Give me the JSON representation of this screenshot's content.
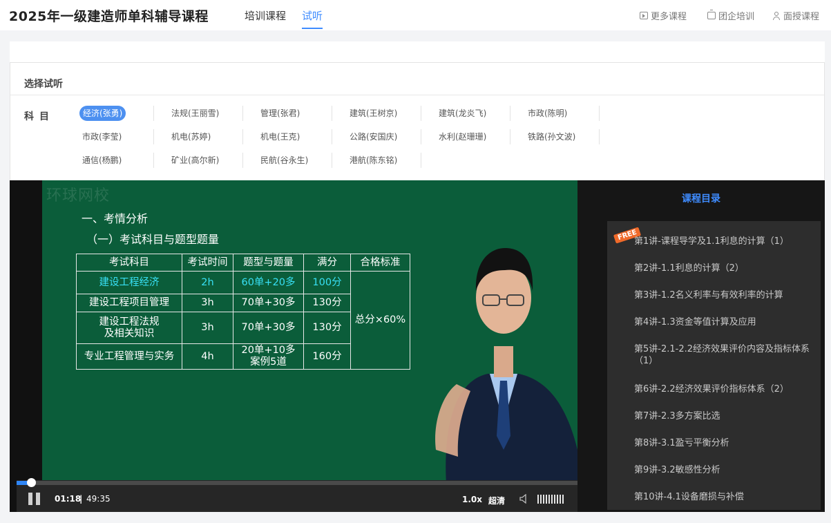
{
  "header": {
    "title": "2025年一级建造师单科辅导课程",
    "tabs": [
      "培训课程",
      "试听"
    ],
    "links": [
      "更多课程",
      "团企培训",
      "面授课程"
    ]
  },
  "selector": {
    "title": "选择试听",
    "subject_label": "科目",
    "subjects": [
      "经济(张勇)",
      "法规(王丽雪)",
      "管理(张君)",
      "建筑(王树京)",
      "建筑(龙炎飞)",
      "市政(陈明)",
      "市政(李莹)",
      "机电(苏婷)",
      "机电(王克)",
      "公路(安国庆)",
      "水利(赵珊珊)",
      "铁路(孙文波)",
      "通信(杨鹏)",
      "矿业(高尔新)",
      "民航(谷永生)",
      "港航(陈东铭)"
    ]
  },
  "video": {
    "watermark": "环球网校",
    "heading1": "一、考情分析",
    "heading2": "（一）考试科目与题型题量",
    "table": {
      "headers": [
        "考试科目",
        "考试时间",
        "题型与题量",
        "满分",
        "合格标准"
      ],
      "rows": [
        [
          "建设工程经济",
          "2h",
          "60单+20多",
          "100分"
        ],
        [
          "建设工程项目管理",
          "3h",
          "70单+30多",
          "130分"
        ],
        [
          "建设工程法规\n及相关知识",
          "3h",
          "70单+30多",
          "130分"
        ],
        [
          "专业工程管理与实务",
          "4h",
          "20单+10多\n案例5道",
          "160分"
        ]
      ],
      "pass_standard": "总分×60%"
    },
    "current_time": "01:18",
    "divider": "|",
    "duration": "49:35",
    "speed": "1.0x",
    "quality": "超清",
    "progress": 0.026
  },
  "catalog": {
    "title": "课程目录",
    "badge": "FREE",
    "lessons": [
      "第1讲-课程导学及1.1利息的计算（1）",
      "第2讲-1.1利息的计算（2）",
      "第3讲-1.2名义利率与有效利率的计算",
      "第4讲-1.3资金等值计算及应用",
      "第5讲-2.1-2.2经济效果评价内容及指标体系（1）",
      "第6讲-2.2经济效果评价指标体系（2）",
      "第7讲-2.3多方案比选",
      "第8讲-3.1盈亏平衡分析",
      "第9讲-3.2敏感性分析",
      "第10讲-4.1设备磨损与补偿"
    ]
  },
  "colors": {
    "accent": "#3f8cff",
    "board": "#0b5d3a",
    "highlight": "#38e0f5",
    "free_badge": "#f06a2a"
  }
}
